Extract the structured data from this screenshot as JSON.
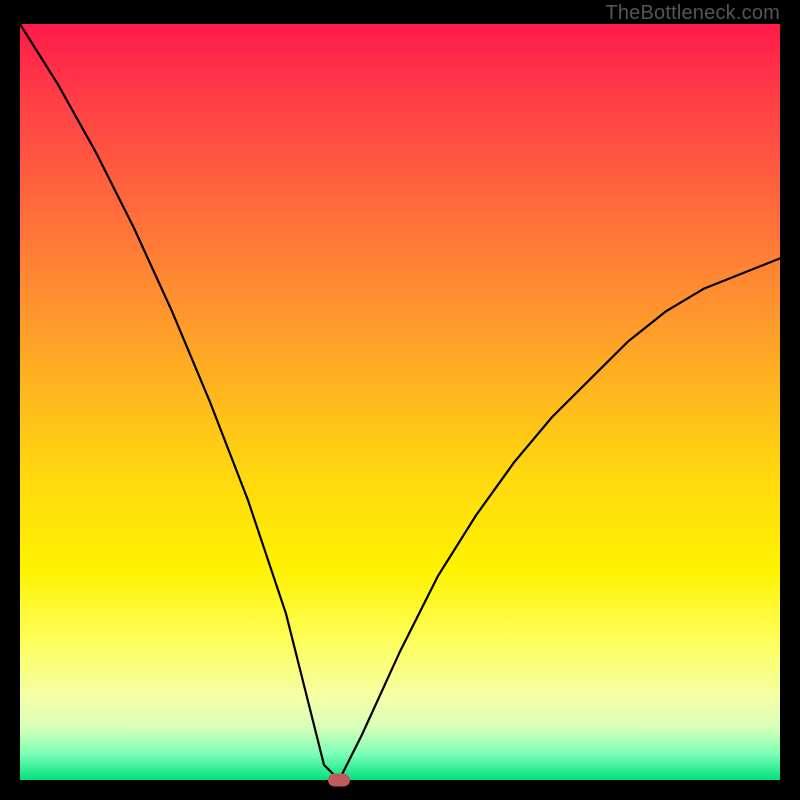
{
  "watermark": "TheBottleneck.com",
  "colors": {
    "frame_bg": "#000000",
    "gradient_top": "#ff1a4b",
    "gradient_bottom": "#00e27f",
    "curve_stroke": "#000000",
    "marker_fill": "#be5b5c"
  },
  "chart_data": {
    "type": "line",
    "title": "",
    "xlabel": "",
    "ylabel": "",
    "xlim": [
      0,
      100
    ],
    "ylim": [
      0,
      100
    ],
    "grid": false,
    "legend": false,
    "x": [
      0,
      5,
      10,
      15,
      20,
      25,
      30,
      35,
      38,
      40,
      42,
      45,
      50,
      55,
      60,
      65,
      70,
      75,
      80,
      85,
      90,
      95,
      100
    ],
    "y": [
      100,
      92,
      83,
      73,
      62,
      50,
      37,
      22,
      10,
      2,
      0,
      6,
      17,
      27,
      35,
      42,
      48,
      53,
      58,
      62,
      65,
      67,
      69
    ],
    "marker": {
      "x": 42,
      "y": 0
    },
    "annotations": []
  }
}
